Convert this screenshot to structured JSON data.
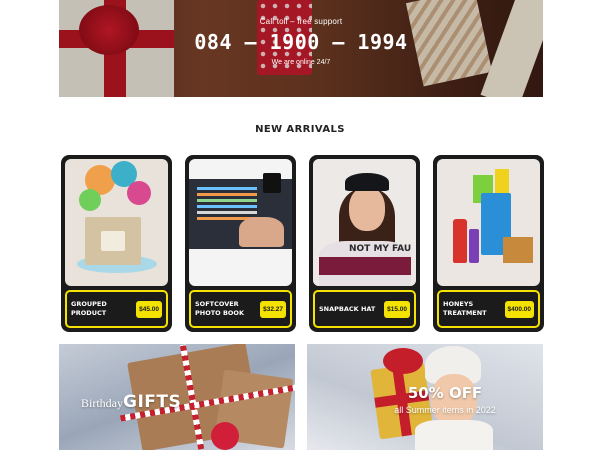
{
  "support_banner": {
    "label": "Call toll – free support",
    "phone": "084 – 1900 – 1994",
    "availability": "We are online 24/7"
  },
  "new_arrivals": {
    "title": "NEW ARRIVALS",
    "products": [
      {
        "name": "GROUPED PRODUCT",
        "price": "$45.00",
        "image": "gift-box-with-paint-splash"
      },
      {
        "name": "SOFTCOVER PHOTO BOOK",
        "price": "$32.27",
        "image": "laptop-typing"
      },
      {
        "name": "SNAPBACK HAT",
        "price": "$15.00",
        "image": "girl-in-snapback",
        "shirt_text": "NOT MY FAU"
      },
      {
        "name": "HONEYS TREATMENT",
        "price": "$400.00",
        "image": "shopping-bags-and-products"
      }
    ]
  },
  "promos": {
    "left": {
      "prefix": "Birthday",
      "headline": "GIFTS"
    },
    "right": {
      "headline": "50% OFF",
      "subtitle": "all Summer items in 2022"
    }
  },
  "colors": {
    "accent": "#f4e200",
    "card": "#1b1b1b",
    "ribbon": "#b81622"
  }
}
